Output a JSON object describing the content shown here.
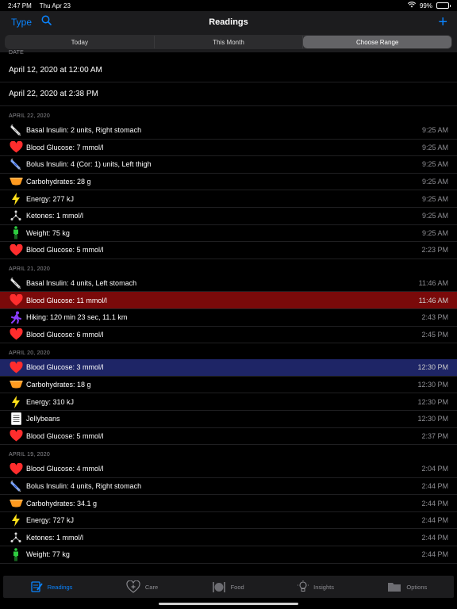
{
  "status": {
    "time": "2:47 PM",
    "date": "Thu Apr 23",
    "battery": "99%"
  },
  "nav": {
    "type_label": "Type",
    "title": "Readings",
    "add_label": "+"
  },
  "segments": [
    {
      "label": "Today",
      "active": false
    },
    {
      "label": "This Month",
      "active": false
    },
    {
      "label": "Choose Range",
      "active": true
    }
  ],
  "range": {
    "header": "DATE",
    "start": "April 12, 2020 at 12:00 AM",
    "end": "April 22, 2020 at 2:38 PM"
  },
  "sections": [
    {
      "header": "APRIL 22, 2020",
      "rows": [
        {
          "icon": "syringe-icon",
          "text": "Basal Insulin: 2 units, Right stomach",
          "time": "9:25 AM"
        },
        {
          "icon": "heart-icon",
          "text": "Blood Glucose: 7 mmol/l",
          "time": "9:25 AM"
        },
        {
          "icon": "syringe-blue-icon",
          "text": "Bolus Insulin: 4 (Cor: 1) units, Left thigh",
          "time": "9:25 AM"
        },
        {
          "icon": "bowl-icon",
          "text": "Carbohydrates: 28 g",
          "time": "9:25 AM"
        },
        {
          "icon": "lightning-icon",
          "text": "Energy: 277 kJ",
          "time": "9:25 AM"
        },
        {
          "icon": "molecule-icon",
          "text": "Ketones: 1 mmol/l",
          "time": "9:25 AM"
        },
        {
          "icon": "person-icon",
          "text": "Weight: 75 kg",
          "time": "9:25 AM"
        },
        {
          "icon": "heart-icon",
          "text": "Blood Glucose: 5 mmol/l",
          "time": "2:23 PM"
        }
      ]
    },
    {
      "header": "APRIL 21, 2020",
      "rows": [
        {
          "icon": "syringe-icon",
          "text": "Basal Insulin: 4 units, Left stomach",
          "time": "11:46 AM"
        },
        {
          "icon": "heart-icon",
          "text": "Blood Glucose: 11 mmol/l",
          "time": "11:46 AM",
          "highlight": "red"
        },
        {
          "icon": "hiker-icon",
          "text": "Hiking: 120 min 23 sec, 11.1 km",
          "time": "2:43 PM"
        },
        {
          "icon": "heart-icon",
          "text": "Blood Glucose: 6 mmol/l",
          "time": "2:45 PM"
        }
      ]
    },
    {
      "header": "APRIL 20, 2020",
      "rows": [
        {
          "icon": "heart-icon",
          "text": "Blood Glucose: 3 mmol/l",
          "time": "12:30 PM",
          "highlight": "blue"
        },
        {
          "icon": "bowl-icon",
          "text": "Carbohydrates: 18 g",
          "time": "12:30 PM"
        },
        {
          "icon": "lightning-icon",
          "text": "Energy: 310 kJ",
          "time": "12:30 PM"
        },
        {
          "icon": "note-icon",
          "text": "Jellybeans",
          "time": "12:30 PM"
        },
        {
          "icon": "heart-icon",
          "text": "Blood Glucose: 5 mmol/l",
          "time": "2:37 PM"
        }
      ]
    },
    {
      "header": "APRIL 19, 2020",
      "rows": [
        {
          "icon": "heart-icon",
          "text": "Blood Glucose: 4 mmol/l",
          "time": "2:04 PM"
        },
        {
          "icon": "syringe-blue-icon",
          "text": "Bolus Insulin: 4 units, Right stomach",
          "time": "2:44 PM"
        },
        {
          "icon": "bowl-icon",
          "text": "Carbohydrates: 34.1 g",
          "time": "2:44 PM"
        },
        {
          "icon": "lightning-icon",
          "text": "Energy: 727 kJ",
          "time": "2:44 PM"
        },
        {
          "icon": "molecule-icon",
          "text": "Ketones: 1 mmol/l",
          "time": "2:44 PM"
        },
        {
          "icon": "person-icon",
          "text": "Weight: 77 kg",
          "time": "2:44 PM"
        }
      ]
    }
  ],
  "tabs": [
    {
      "label": "Readings",
      "icon": "readings-icon",
      "active": true
    },
    {
      "label": "Care",
      "icon": "care-icon",
      "active": false
    },
    {
      "label": "Food",
      "icon": "food-icon",
      "active": false
    },
    {
      "label": "Insights",
      "icon": "insights-icon",
      "active": false
    },
    {
      "label": "Options",
      "icon": "folder-icon",
      "active": false
    }
  ],
  "colors": {
    "accent": "#0a84ff",
    "highlight_red": "#7a0a0a",
    "highlight_blue": "#1e2566",
    "heart": "#ff2d2d"
  }
}
